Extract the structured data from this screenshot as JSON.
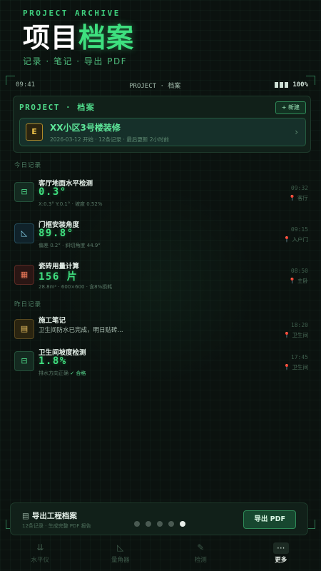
{
  "hero": {
    "kicker": "PROJECT ARCHIVE",
    "title_white": "项目",
    "title_green": "档案",
    "subtitle": "记录 · 笔记 · 导出 PDF"
  },
  "status": {
    "time": "09:41",
    "center": "PROJECT · 档案",
    "battery": "100%"
  },
  "project": {
    "label": "PROJECT · 档案",
    "new_button": "+ 新建",
    "icon": "building-icon",
    "name": "XX小区3号楼装修",
    "meta": "2026-03-12 开始 · 12条记录 · 最后更新 2小时前"
  },
  "today_label": "今日记录",
  "yesterday_label": "昨日记录",
  "today": [
    {
      "icon": "level-icon",
      "title": "客厅地面水平检测",
      "value": "0.3°",
      "detail": "X:0.3° Y:0.1° · 坡度 0.52%",
      "time": "09:32",
      "location": "客厅"
    },
    {
      "icon": "angle-icon",
      "title": "门框安装角度",
      "value": "89.8°",
      "detail": "偏差 0.2° · 斜切角度 44.9°",
      "time": "09:15",
      "location": "入户门"
    },
    {
      "icon": "tile-icon",
      "title": "瓷砖用量计算",
      "value": "156 片",
      "detail": "28.8m² · 600×600 · 含8%损耗",
      "time": "08:50",
      "location": "主卧"
    }
  ],
  "yesterday": [
    {
      "icon": "note-icon",
      "title": "施工笔记",
      "text": "卫生间防水已完成，明日贴砖...",
      "time": "18:20",
      "location": "卫生间"
    },
    {
      "icon": "level-icon",
      "title": "卫生间坡度检测",
      "value": "1.8%",
      "detail": "排水方向正确",
      "status": "✓ 合格",
      "time": "17:45",
      "location": "卫生间"
    }
  ],
  "export": {
    "title": "导出工程档案",
    "subtitle": "12条记录 · 生成完整 PDF 报告",
    "button": "导出 PDF"
  },
  "pagination": {
    "count": 5,
    "active": 5
  },
  "tabs": [
    {
      "icon": "level-icon",
      "label": "水平仪"
    },
    {
      "icon": "protractor-icon",
      "label": "量角器"
    },
    {
      "icon": "brush-icon",
      "label": "检测"
    },
    {
      "icon": "more-icon",
      "label": "更多",
      "active": true
    }
  ]
}
